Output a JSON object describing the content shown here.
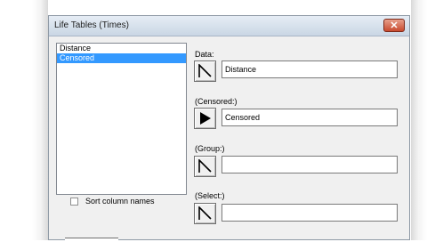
{
  "window": {
    "title": "Life Tables (Times)",
    "close_icon": "✕"
  },
  "variables": {
    "items": [
      {
        "label": "Distance",
        "selected": false
      },
      {
        "label": "Censored",
        "selected": true
      }
    ]
  },
  "sort": {
    "label": "Sort column names",
    "checked": false
  },
  "fields": {
    "data": {
      "label": "Data:",
      "value": "Distance",
      "button_icon": "arrow-outline-icon"
    },
    "censored": {
      "label": "(Censored:)",
      "value": "Censored",
      "button_icon": "arrow-filled-icon"
    },
    "group": {
      "label": "(Group:)",
      "value": "",
      "button_icon": "arrow-outline-icon"
    },
    "select": {
      "label": "(Select:)",
      "value": "",
      "button_icon": "arrow-outline-icon"
    }
  },
  "colors": {
    "selection": "#3399ff",
    "dialog_bg": "#f0f0f0",
    "close_button": "#c84a2e"
  }
}
